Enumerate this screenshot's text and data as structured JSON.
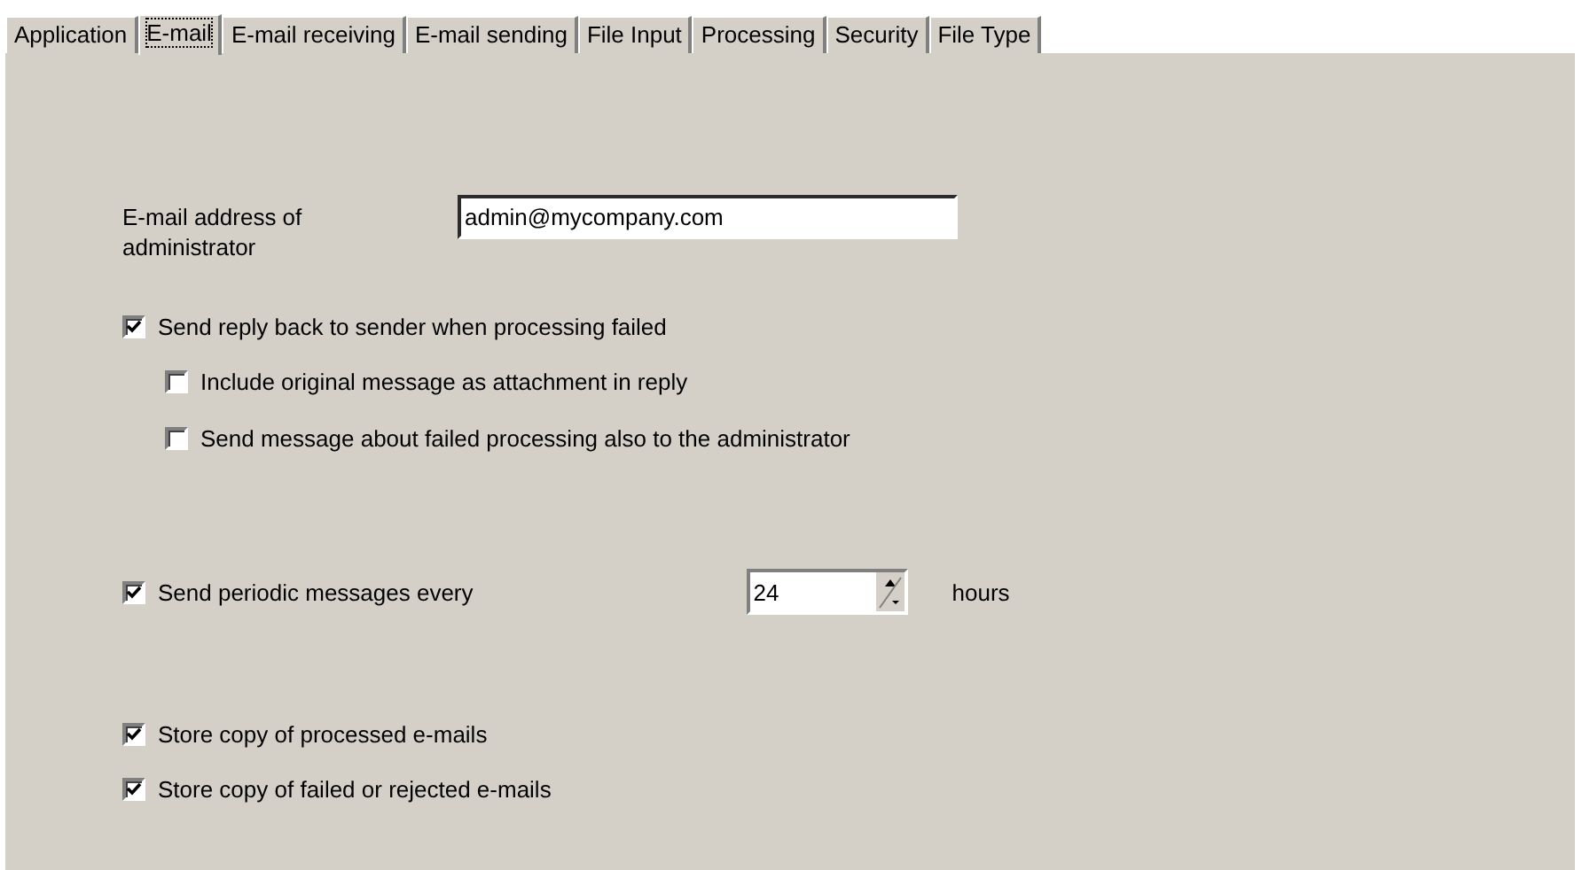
{
  "tabs": [
    {
      "label": "Application",
      "selected": false
    },
    {
      "label": "E-mail",
      "selected": true
    },
    {
      "label": "E-mail receiving",
      "selected": false
    },
    {
      "label": "E-mail sending",
      "selected": false
    },
    {
      "label": "File Input",
      "selected": false
    },
    {
      "label": "Processing",
      "selected": false
    },
    {
      "label": "Security",
      "selected": false
    },
    {
      "label": "File Type",
      "selected": false
    }
  ],
  "admin_email": {
    "label": "E-mail address of administrator",
    "value": "admin@mycompany.com"
  },
  "reply_options": [
    {
      "label": "Send reply back to sender when processing failed",
      "checked": true,
      "children": [
        {
          "label": "Include original message as attachment in reply",
          "checked": false
        },
        {
          "label": "Send message about failed processing also to the administrator",
          "checked": false
        }
      ]
    }
  ],
  "periodic": {
    "label": "Send periodic messages every",
    "checked": true,
    "value": "24",
    "unit": "hours"
  },
  "store_options": [
    {
      "label": "Store copy of processed e-mails",
      "checked": true
    },
    {
      "label": "Store copy of failed or rejected e-mails",
      "checked": true
    }
  ]
}
